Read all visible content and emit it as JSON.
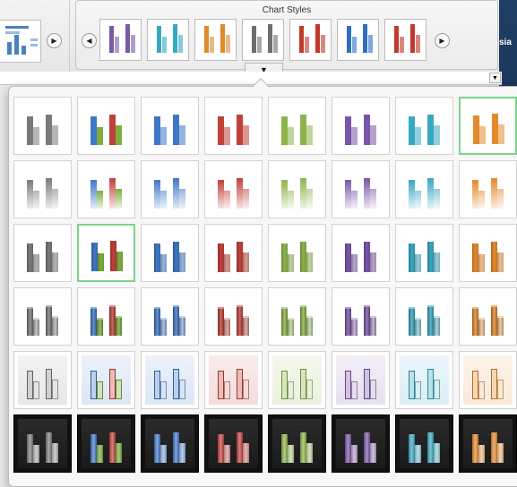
{
  "ribbon": {
    "chart_styles_title": "Chart Styles",
    "scroll_left_glyph": "◀",
    "scroll_right_glyph": "▶",
    "expand_glyph": "▼",
    "formula_dropdown_glyph": "▼",
    "right_edge_fragment": "sia",
    "preview_thumbnails": [
      {
        "color": "#7a5aa6"
      },
      {
        "color": "#36a9c1"
      },
      {
        "color": "#e08a2c"
      },
      {
        "color": "#6e6e6e"
      },
      {
        "color": "#c0392b"
      },
      {
        "color": "#2e6fbf"
      },
      {
        "color": "#c0392b"
      }
    ]
  },
  "palette": {
    "gray": "#7a7a7a",
    "multi": "#3f77c7",
    "blue": "#3f77c7",
    "red": "#c0413a",
    "green": "#8cb44a",
    "purple": "#7a56a8",
    "teal": "#38a8c2",
    "orange": "#e58a2c",
    "multi_secondary": "#c0413a",
    "multi_tertiary": "#7fae3e"
  },
  "gallery": {
    "columns": [
      "gray",
      "multi",
      "blue",
      "red",
      "green",
      "purple",
      "teal",
      "orange"
    ],
    "rows": [
      {
        "variant": "flat"
      },
      {
        "variant": "faded"
      },
      {
        "variant": "shaded"
      },
      {
        "variant": "3d"
      },
      {
        "variant": "outlined"
      },
      {
        "variant": "dark"
      }
    ],
    "selected": [
      {
        "row": 0,
        "col": 7
      },
      {
        "row": 2,
        "col": 1
      }
    ]
  }
}
